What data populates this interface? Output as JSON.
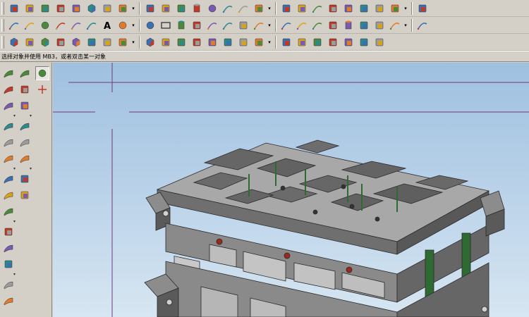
{
  "status": {
    "prompt": "选择对象并使用 MB3，或者双击某一对象"
  },
  "colors": {
    "toolbar_bg": "#d4d0c8",
    "viewport_top": "#9fc0e0",
    "viewport_bottom": "#d7e6f2",
    "model_face": "#9c9c9c",
    "model_dark": "#5e5e5e",
    "model_edge": "#2a2a2a",
    "bolt_color": "#9a2a1e",
    "guide_pillar": "#2f6a33",
    "datum_line": "#6d3c78"
  },
  "toolbars": {
    "row1": [
      "select-filter-icon",
      "paste-icon",
      "rotate-icon",
      "zoom-tools-icon",
      "layer-icon",
      "shaded-cube-icon",
      "orient-icon",
      "view-fit-icon",
      "sketch-icon",
      "image-icon",
      "model-icon",
      "cylinder-icon",
      "sphere-icon",
      "line-icon",
      "arc-icon",
      "extrude-icon",
      "revolve-icon",
      "pocket-icon",
      "curve-icon",
      "sweep-icon",
      "blend-icon",
      "chamfer-icon",
      "offset-icon",
      "trim-icon",
      "corner-icon"
    ],
    "row2": [
      "line-tool-icon",
      "arc-tool-icon",
      "circle-tool-icon",
      "spline-icon",
      "conic-icon",
      "offset-curve-icon",
      "text-icon",
      "point-icon",
      "point-set-icon",
      "rectangle-icon",
      "cylinder-grey-icon",
      "mesh-icon",
      "fillet-curve-icon",
      "bridge-curve-icon",
      "project-icon",
      "intersect-curve-icon",
      "section-curve-icon",
      "extract-curve-icon",
      "join-curve-icon",
      "wrap-icon",
      "tube-icon",
      "isoparam-icon",
      "combine-icon",
      "scale-curve-icon",
      "edit-curve-icon"
    ],
    "row3": [
      "mold-wizard-icon",
      "init-project-icon",
      "workpiece-icon",
      "cavity-layout-icon",
      "insert-icon",
      "parting-icon",
      "sliders-icon",
      "ejector-icon",
      "mold-base-icon",
      "standard-parts-icon",
      "sprue-icon",
      "runner-icon",
      "gate-icon",
      "cooling-icon",
      "electrode-icon",
      "trim-tool-icon",
      "pocket-tool-icon",
      "bom-icon",
      "drawing-icon",
      "view-manager-icon",
      "unused-parts-icon",
      "clone-icon",
      "delete-icon"
    ]
  },
  "left_toolbars": {
    "col1": [
      "surface-icon",
      "ruled-surface-icon",
      "mesh-surface-icon",
      "sweep-surface-icon",
      "section-surface-icon",
      "bounded-plane-icon",
      "offset-surface-icon",
      "trim-surface-icon",
      "extend-surface-icon",
      "sew-icon",
      "quilt-icon",
      "thicken-icon",
      "large-surface-icon",
      "patch-icon",
      "bend-icon",
      "torus-surface-icon"
    ],
    "col2": [
      "extrude-surface-icon",
      "face-blend-icon",
      "styled-blend-icon",
      "bridge-surface-icon",
      "draft-surface-icon",
      "flange-surface-icon",
      "spread-icon",
      "unbend-icon"
    ],
    "col3": [
      "snap-point-icon",
      "wcs-icon"
    ]
  }
}
